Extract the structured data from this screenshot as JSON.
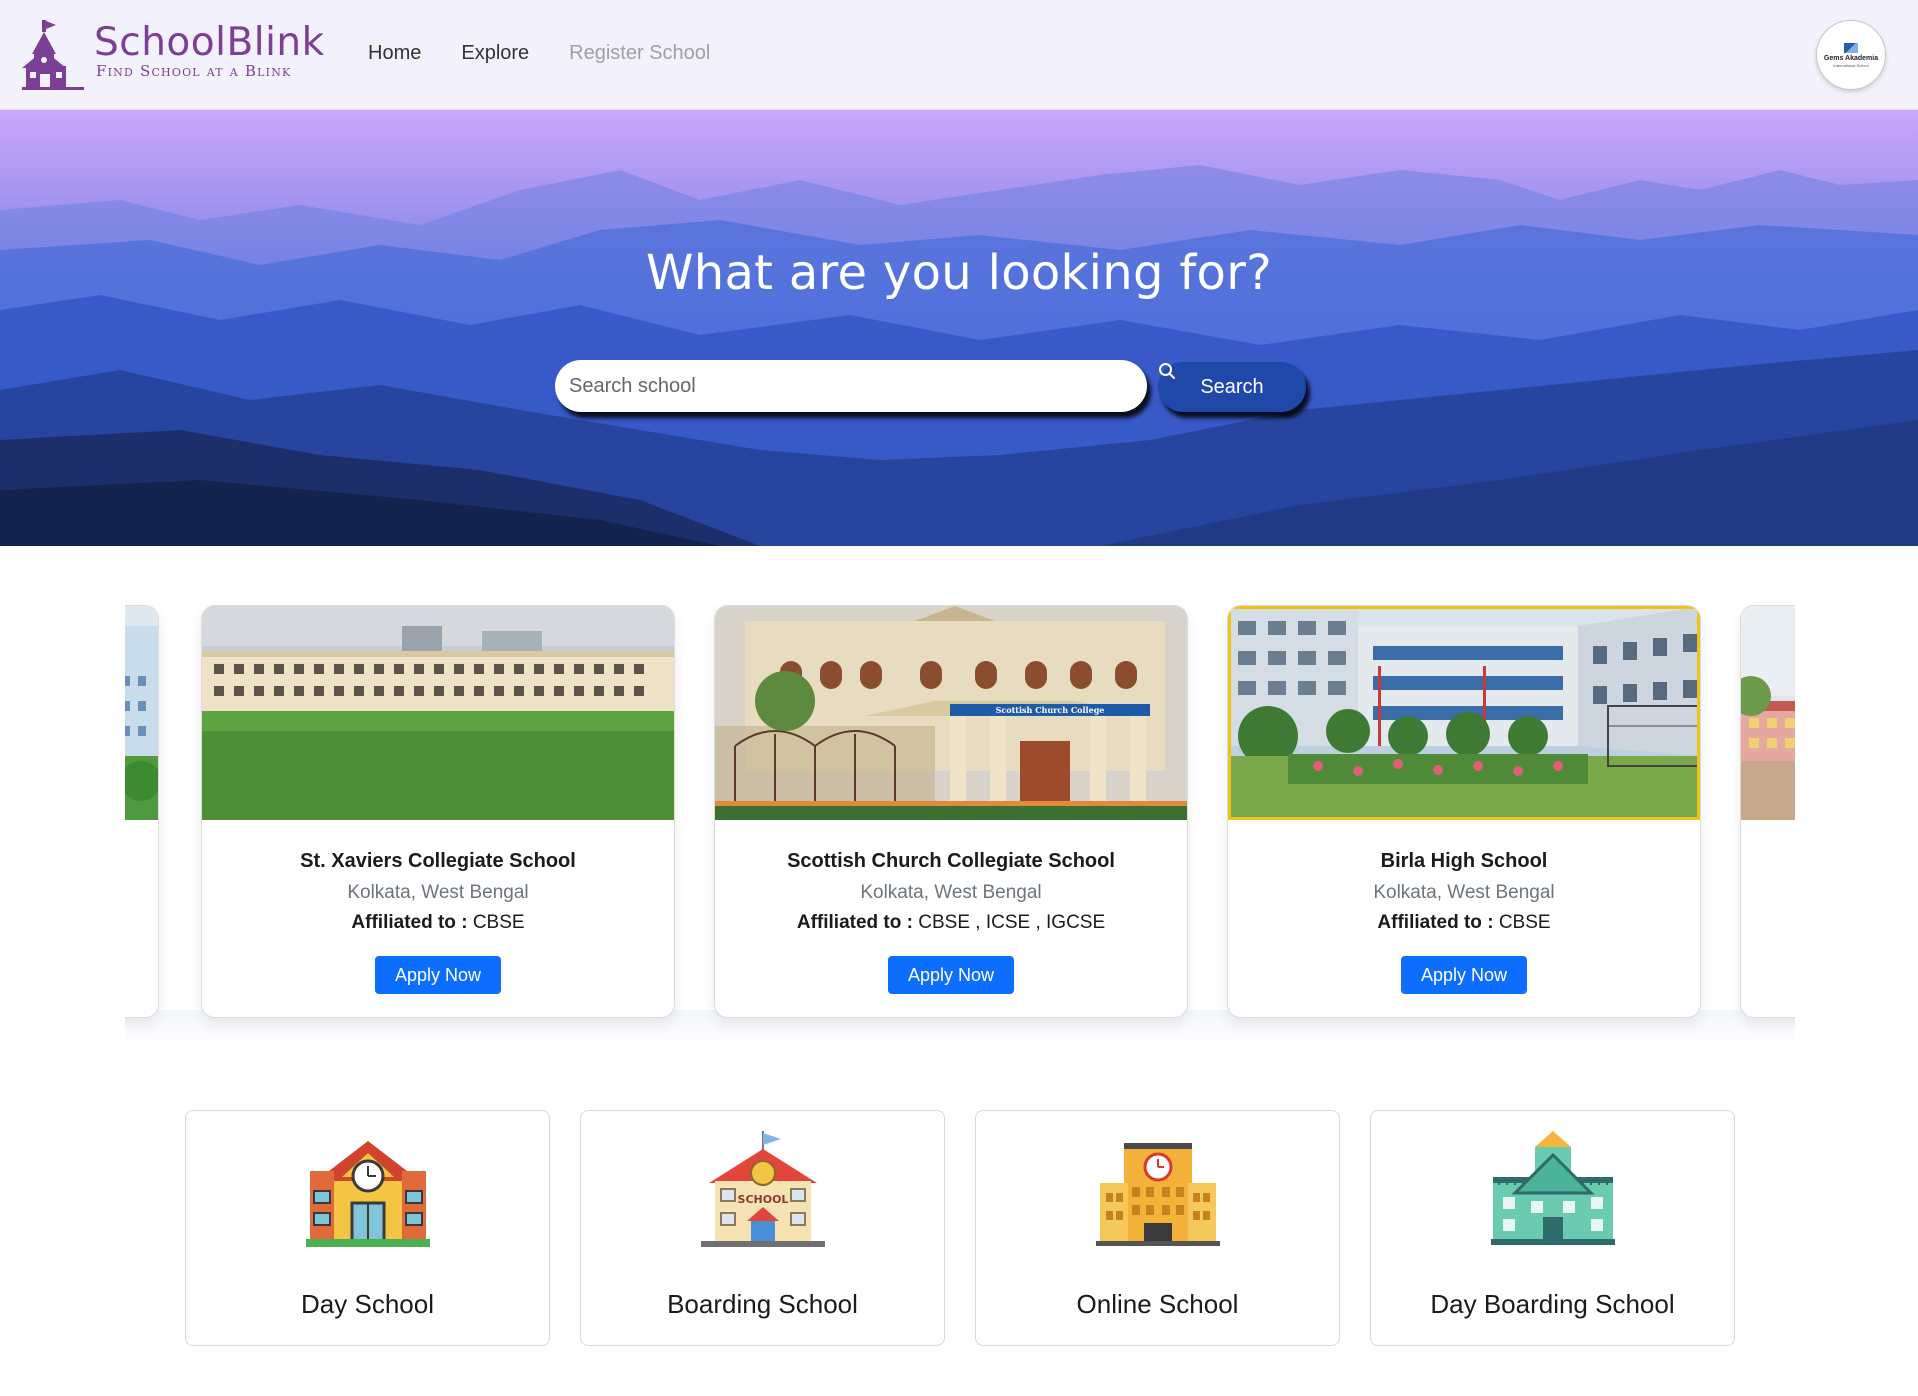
{
  "nav": {
    "brand_title": "SchoolBlink",
    "brand_tagline": "Find School at a Blink",
    "links": [
      {
        "label": "Home"
      },
      {
        "label": "Explore"
      },
      {
        "label": "Register School"
      }
    ],
    "profile_name": "Gems Akademia",
    "profile_sub": "International School"
  },
  "hero": {
    "title": "What are you looking for?",
    "search_placeholder": "Search school",
    "search_button": "Search"
  },
  "schools": [
    {
      "name": "St. Xaviers Collegiate School",
      "location": "Kolkata, West Bengal",
      "affiliation_label": "Affiliated to :",
      "affiliation": "CBSE",
      "button": "Apply Now"
    },
    {
      "name": "Scottish Church Collegiate School",
      "location": "Kolkata, West Bengal",
      "affiliation_label": "Affiliated to :",
      "affiliation": "CBSE , ICSE , IGCSE",
      "button": "Apply Now",
      "sign_text": "Scottish Church College"
    },
    {
      "name": "Birla High School",
      "location": "Kolkata, West Bengal",
      "affiliation_label": "Affiliated to :",
      "affiliation": "CBSE",
      "button": "Apply Now"
    }
  ],
  "categories": [
    {
      "label": "Day School",
      "icon": "day-school-icon"
    },
    {
      "label": "Boarding School",
      "icon": "boarding-school-icon",
      "sign": "SCHOOL"
    },
    {
      "label": "Online School",
      "icon": "online-school-icon"
    },
    {
      "label": "Day Boarding School",
      "icon": "day-boarding-school-icon"
    }
  ],
  "colors": {
    "brand": "#7b3f95",
    "primary": "#0d6efd",
    "search_button": "#1f48a8"
  }
}
